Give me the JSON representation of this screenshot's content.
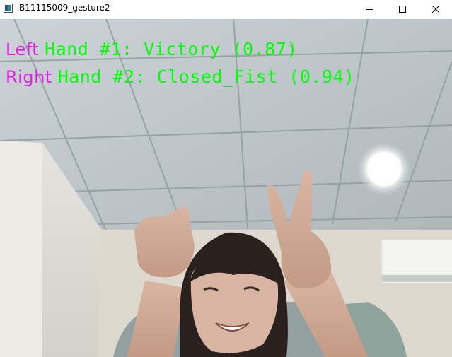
{
  "window": {
    "title": "B11115009_gesture2",
    "icon": "window-app-icon",
    "controls": {
      "minimize_icon": "minimize-icon",
      "maximize_icon": "maximize-icon",
      "close_icon": "close-icon"
    }
  },
  "overlay": {
    "side_color": "#e61fe6",
    "label_color": "#00ff00",
    "hands": [
      {
        "side": "Left",
        "label": "Hand #1: Victory (0.87)"
      },
      {
        "side": "Right",
        "label": "Hand #2: Closed_Fist (0.94)"
      }
    ]
  }
}
